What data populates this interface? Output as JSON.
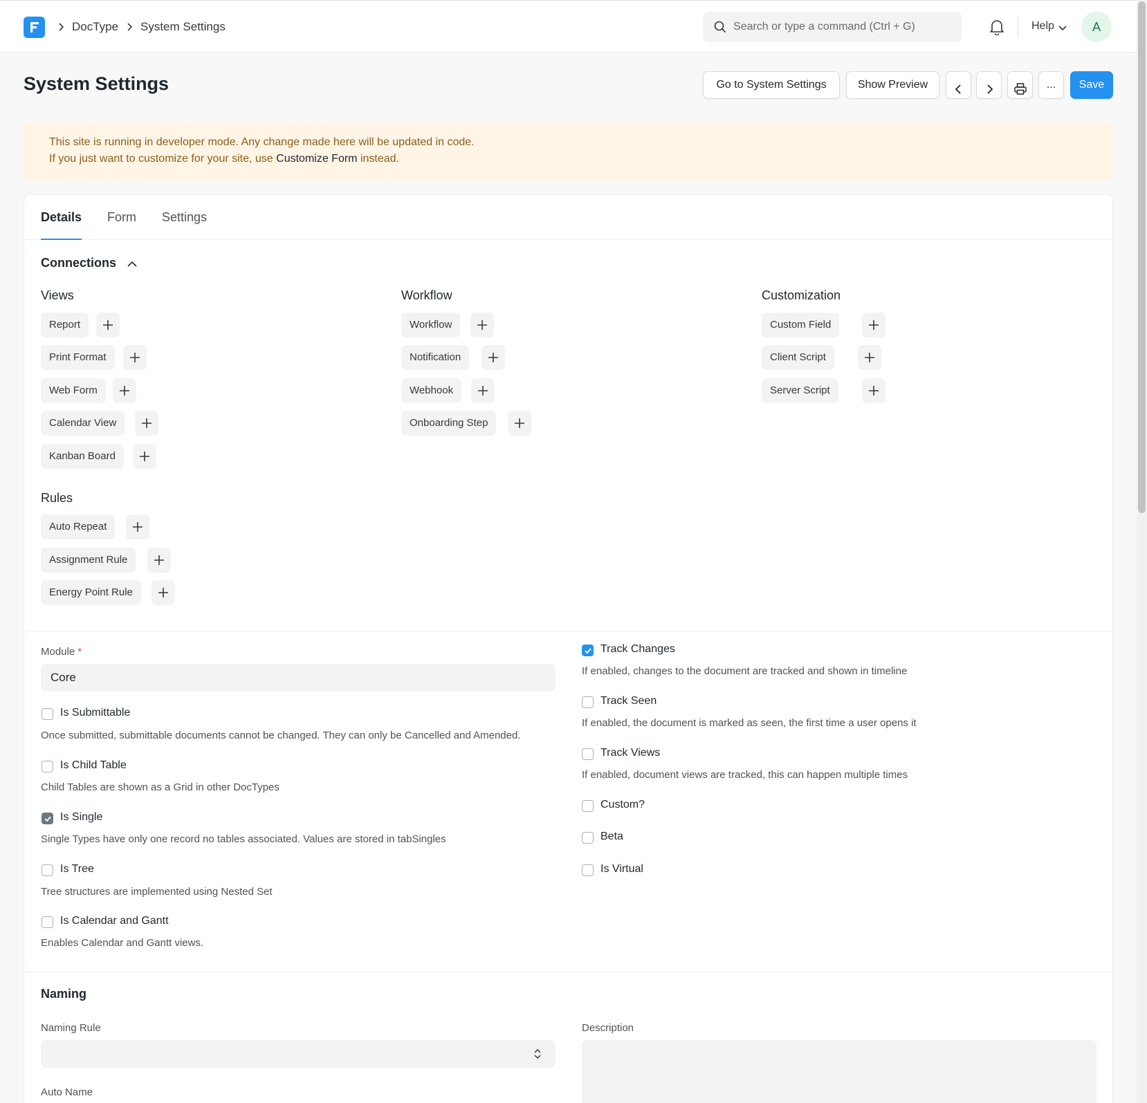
{
  "navbar": {
    "breadcrumbs": [
      "DocType",
      "System Settings"
    ],
    "search_placeholder": "Search or type a command (Ctrl + G)",
    "help_label": "Help",
    "avatar_initial": "A"
  },
  "page": {
    "title": "System Settings",
    "buttons": {
      "go_to": "Go to System Settings",
      "show_preview": "Show Preview",
      "more": "...",
      "save": "Save"
    }
  },
  "alert": {
    "line1": "This site is running in developer mode. Any change made here will be updated in code.",
    "line2_prefix": "If you just want to customize for your site, use ",
    "line2_link": "Customize Form",
    "line2_suffix": " instead."
  },
  "tabs": [
    "Details",
    "Form",
    "Settings"
  ],
  "connections": {
    "title": "Connections",
    "groups": [
      {
        "title": "Views",
        "items": [
          "Report",
          "Print Format",
          "Web Form",
          "Calendar View",
          "Kanban Board"
        ]
      },
      {
        "title": "Workflow",
        "items": [
          "Workflow",
          "Notification",
          "Webhook",
          "Onboarding Step"
        ]
      },
      {
        "title": "Customization",
        "items": [
          "Custom Field",
          "Client Script",
          "Server Script"
        ]
      },
      {
        "title": "Rules",
        "items": [
          "Auto Repeat",
          "Assignment Rule",
          "Energy Point Rule"
        ]
      }
    ]
  },
  "details": {
    "module_label": "Module",
    "module_required": "*",
    "module_value": "Core",
    "left_checks": [
      {
        "label": "Is Submittable",
        "checked": false,
        "desc": "Once submitted, submittable documents cannot be changed. They can only be Cancelled and Amended."
      },
      {
        "label": "Is Child Table",
        "checked": false,
        "desc": "Child Tables are shown as a Grid in other DocTypes"
      },
      {
        "label": "Is Single",
        "checked": true,
        "desc": "Single Types have only one record no tables associated. Values are stored in tabSingles"
      },
      {
        "label": "Is Tree",
        "checked": false,
        "desc": "Tree structures are implemented using Nested Set"
      },
      {
        "label": "Is Calendar and Gantt",
        "checked": false,
        "desc": "Enables Calendar and Gantt views."
      }
    ],
    "right_checks": [
      {
        "label": "Track Changes",
        "checked": true,
        "desc": "If enabled, changes to the document are tracked and shown in timeline"
      },
      {
        "label": "Track Seen",
        "checked": false,
        "desc": "If enabled, the document is marked as seen, the first time a user opens it"
      },
      {
        "label": "Track Views",
        "checked": false,
        "desc": "If enabled, document views are tracked, this can happen multiple times"
      },
      {
        "label": "Custom?",
        "checked": false,
        "desc": ""
      },
      {
        "label": "Beta",
        "checked": false,
        "desc": ""
      },
      {
        "label": "Is Virtual",
        "checked": false,
        "desc": ""
      }
    ]
  },
  "naming": {
    "title": "Naming",
    "naming_rule_label": "Naming Rule",
    "naming_rule_value": "",
    "auto_name_label": "Auto Name",
    "description_label": "Description"
  },
  "colors": {
    "primary": "#2490ef",
    "alert_bg": "#fff5e6",
    "alert_text": "#8d5e19"
  }
}
